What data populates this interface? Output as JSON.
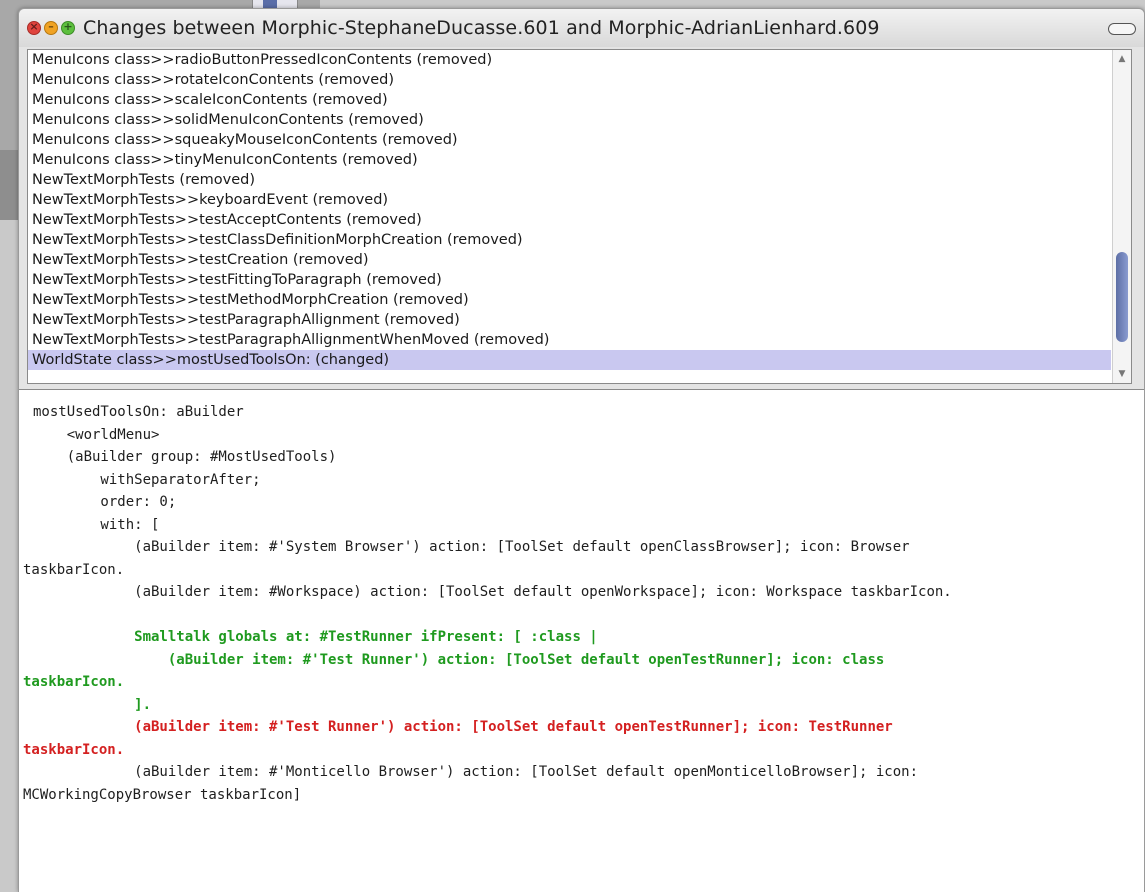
{
  "window": {
    "title": "Changes between Morphic-StephaneDucasse.601 and Morphic-AdrianLienhard.609"
  },
  "changes": [
    "MenuIcons class>>radioButtonPressedIconContents (removed)",
    "MenuIcons class>>rotateIconContents (removed)",
    "MenuIcons class>>scaleIconContents (removed)",
    "MenuIcons class>>solidMenuIconContents (removed)",
    "MenuIcons class>>squeakyMouseIconContents (removed)",
    "MenuIcons class>>tinyMenuIconContents (removed)",
    "NewTextMorphTests (removed)",
    "NewTextMorphTests>>keyboardEvent (removed)",
    "NewTextMorphTests>>testAcceptContents (removed)",
    "NewTextMorphTests>>testClassDefinitionMorphCreation (removed)",
    "NewTextMorphTests>>testCreation (removed)",
    "NewTextMorphTests>>testFittingToParagraph (removed)",
    "NewTextMorphTests>>testMethodMorphCreation (removed)",
    "NewTextMorphTests>>testParagraphAllignment (removed)",
    "NewTextMorphTests>>testParagraphAllignmentWhenMoved (removed)",
    "WorldState class>>mostUsedToolsOn: (changed)"
  ],
  "selected_change_index": 15,
  "scroll_position": 0.88,
  "code": {
    "lines": [
      {
        "text": "mostUsedToolsOn: aBuilder",
        "style": "normal"
      },
      {
        "text": "    <worldMenu>",
        "style": "normal"
      },
      {
        "text": "    (aBuilder group: #MostUsedTools)",
        "style": "normal"
      },
      {
        "text": "        withSeparatorAfter;",
        "style": "normal"
      },
      {
        "text": "        order: 0;",
        "style": "normal"
      },
      {
        "text": "        with: [",
        "style": "normal"
      },
      {
        "text": "            (aBuilder item: #'System Browser') action: [ToolSet default openClassBrowser]; icon: Browser",
        "style": "normal"
      },
      {
        "text": "taskbarIcon.",
        "style": "normal"
      },
      {
        "text": "            (aBuilder item: #Workspace) action: [ToolSet default openWorkspace]; icon: Workspace taskbarIcon.",
        "style": "normal"
      },
      {
        "text": "",
        "style": "normal"
      },
      {
        "text": "            Smalltalk globals at: #TestRunner ifPresent: [ :class |",
        "style": "added"
      },
      {
        "text": "                (aBuilder item: #'Test Runner') action: [ToolSet default openTestRunner]; icon: class",
        "style": "added"
      },
      {
        "text": "taskbarIcon.",
        "style": "added"
      },
      {
        "text": "            ].",
        "style": "added"
      },
      {
        "text": "            (aBuilder item: #'Test Runner') action: [ToolSet default openTestRunner]; icon: TestRunner",
        "style": "removed"
      },
      {
        "text": "taskbarIcon.",
        "style": "removed"
      },
      {
        "text": "            (aBuilder item: #'Monticello Browser') action: [ToolSet default openMonticelloBrowser]; icon:",
        "style": "normal"
      },
      {
        "text": "MCWorkingCopyBrowser taskbarIcon]",
        "style": "normal"
      }
    ]
  },
  "colors": {
    "added": "#1f9a1f",
    "removed": "#d42020",
    "selection": "#c9c8f0"
  }
}
